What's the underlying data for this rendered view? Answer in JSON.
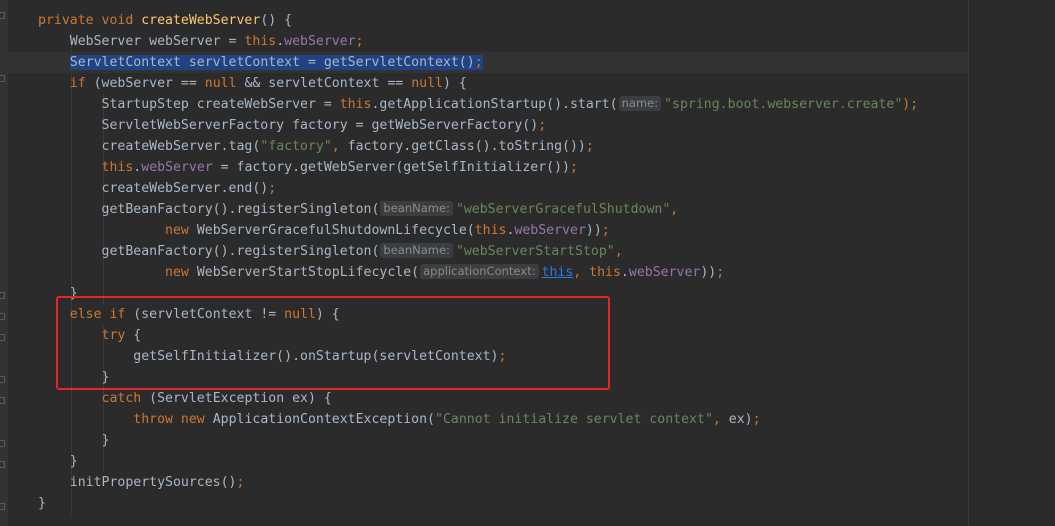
{
  "editor": {
    "language": "java",
    "highlighted_region": "else-if-servletContext-branch",
    "lines": [
      [
        {
          "t": "private void ",
          "c": "kw"
        },
        {
          "t": "createWebServer",
          "c": "fn"
        },
        {
          "t": "() {",
          "c": "plain"
        }
      ],
      [
        {
          "t": "    WebServer webServer = ",
          "c": "plain"
        },
        {
          "t": "this",
          "c": "kw"
        },
        {
          "t": ".",
          "c": "plain"
        },
        {
          "t": "webServer",
          "c": "fld"
        },
        {
          "t": ";",
          "c": "kw"
        }
      ],
      [
        {
          "t": "    ",
          "c": "plain"
        },
        {
          "t": "ServletContext servletContext = getServletContext()",
          "c": "sel"
        },
        {
          "t": ";",
          "c": "kw sel"
        }
      ],
      [
        {
          "t": "    ",
          "c": "plain"
        },
        {
          "t": "if ",
          "c": "kw"
        },
        {
          "t": "(webServer == ",
          "c": "plain"
        },
        {
          "t": "null ",
          "c": "kw"
        },
        {
          "t": "&& servletContext == ",
          "c": "plain"
        },
        {
          "t": "null",
          "c": "kw"
        },
        {
          "t": ") {",
          "c": "plain"
        }
      ],
      [
        {
          "t": "        StartupStep createWebServer = ",
          "c": "plain"
        },
        {
          "t": "this",
          "c": "kw"
        },
        {
          "t": ".getApplicationStartup().start(",
          "c": "plain"
        },
        {
          "t": "name:",
          "c": "hint"
        },
        {
          "t": "\"spring.boot.webserver.create\"",
          "c": "str"
        },
        {
          "t": ");",
          "c": "kw"
        }
      ],
      [
        {
          "t": "        ServletWebServerFactory factory = getWebServerFactory()",
          "c": "plain"
        },
        {
          "t": ";",
          "c": "kw"
        }
      ],
      [
        {
          "t": "        createWebServer.tag(",
          "c": "plain"
        },
        {
          "t": "\"factory\"",
          "c": "str"
        },
        {
          "t": ", ",
          "c": "kw"
        },
        {
          "t": "factory.getClass().toString())",
          "c": "plain"
        },
        {
          "t": ";",
          "c": "kw"
        }
      ],
      [
        {
          "t": "        ",
          "c": "plain"
        },
        {
          "t": "this",
          "c": "kw"
        },
        {
          "t": ".",
          "c": "plain"
        },
        {
          "t": "webServer",
          "c": "fld"
        },
        {
          "t": " = factory.getWebServer(getSelfInitializer())",
          "c": "plain"
        },
        {
          "t": ";",
          "c": "kw"
        }
      ],
      [
        {
          "t": "        createWebServer.end()",
          "c": "plain"
        },
        {
          "t": ";",
          "c": "kw"
        }
      ],
      [
        {
          "t": "        getBeanFactory().registerSingleton(",
          "c": "plain"
        },
        {
          "t": "beanName:",
          "c": "hint"
        },
        {
          "t": "\"webServerGracefulShutdown\"",
          "c": "str"
        },
        {
          "t": ",",
          "c": "kw"
        }
      ],
      [
        {
          "t": "                ",
          "c": "plain"
        },
        {
          "t": "new ",
          "c": "kw"
        },
        {
          "t": "WebServerGracefulShutdownLifecycle(",
          "c": "plain"
        },
        {
          "t": "this",
          "c": "kw"
        },
        {
          "t": ".",
          "c": "plain"
        },
        {
          "t": "webServer",
          "c": "fld"
        },
        {
          "t": "))",
          "c": "plain"
        },
        {
          "t": ";",
          "c": "kw"
        }
      ],
      [
        {
          "t": "        getBeanFactory().registerSingleton(",
          "c": "plain"
        },
        {
          "t": "beanName:",
          "c": "hint"
        },
        {
          "t": "\"webServerStartStop\"",
          "c": "str"
        },
        {
          "t": ",",
          "c": "kw"
        }
      ],
      [
        {
          "t": "                ",
          "c": "plain"
        },
        {
          "t": "new ",
          "c": "kw"
        },
        {
          "t": "WebServerStartStopLifecycle(",
          "c": "plain"
        },
        {
          "t": "applicationContext:",
          "c": "hint"
        },
        {
          "t": "this",
          "c": "ulink"
        },
        {
          "t": ", ",
          "c": "kw"
        },
        {
          "t": "this",
          "c": "kw"
        },
        {
          "t": ".",
          "c": "plain"
        },
        {
          "t": "webServer",
          "c": "fld"
        },
        {
          "t": "))",
          "c": "plain"
        },
        {
          "t": ";",
          "c": "kw"
        }
      ],
      [
        {
          "t": "    }",
          "c": "plain"
        }
      ],
      [
        {
          "t": "    ",
          "c": "plain"
        },
        {
          "t": "else if ",
          "c": "kw"
        },
        {
          "t": "(servletContext != ",
          "c": "plain"
        },
        {
          "t": "null",
          "c": "kw"
        },
        {
          "t": ") {",
          "c": "plain"
        }
      ],
      [
        {
          "t": "        ",
          "c": "plain"
        },
        {
          "t": "try ",
          "c": "kw"
        },
        {
          "t": "{",
          "c": "plain"
        }
      ],
      [
        {
          "t": "            getSelfInitializer().onStartup(servletContext)",
          "c": "plain"
        },
        {
          "t": ";",
          "c": "kw"
        }
      ],
      [
        {
          "t": "        }",
          "c": "plain"
        }
      ],
      [
        {
          "t": "        ",
          "c": "plain"
        },
        {
          "t": "catch ",
          "c": "kw"
        },
        {
          "t": "(ServletException ex) {",
          "c": "plain"
        }
      ],
      [
        {
          "t": "            ",
          "c": "plain"
        },
        {
          "t": "throw new ",
          "c": "kw"
        },
        {
          "t": "ApplicationContextException(",
          "c": "plain"
        },
        {
          "t": "\"Cannot initialize servlet context\"",
          "c": "str"
        },
        {
          "t": ", ",
          "c": "kw"
        },
        {
          "t": "ex)",
          "c": "plain"
        },
        {
          "t": ";",
          "c": "kw"
        }
      ],
      [
        {
          "t": "        }",
          "c": "plain"
        }
      ],
      [
        {
          "t": "    }",
          "c": "plain"
        }
      ],
      [
        {
          "t": "    initPropertySources()",
          "c": "plain"
        },
        {
          "t": ";",
          "c": "kw"
        }
      ],
      [
        {
          "t": "}",
          "c": "plain"
        }
      ]
    ]
  },
  "gutter": {
    "intention_icon": "lightbulb-icon",
    "fold_icon": "fold-marker-icon"
  },
  "colors": {
    "background": "#2b2b2b",
    "keyword": "#cc7832",
    "field": "#9876aa",
    "method_declaration": "#ffc66d",
    "string": "#6a8759",
    "text": "#a9b7c6",
    "selection": "#214283",
    "highlight_box": "#e3262a"
  }
}
